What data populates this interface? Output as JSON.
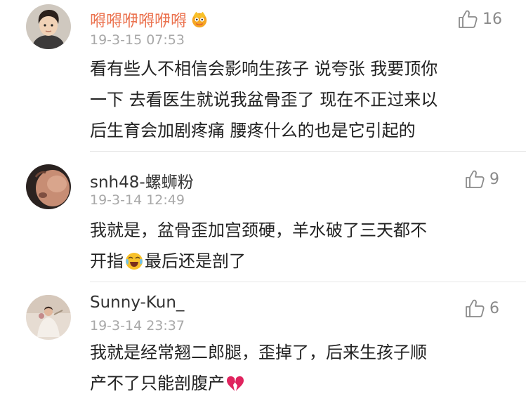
{
  "comments": [
    {
      "username": "嘚嘚咿嘚咿嘚",
      "timestamp": "19-3-15 07:53",
      "likes": "16",
      "text_lines": [
        "看有些人不相信会影响生孩子 说夸张 我要顶你",
        "一下 去看医生就说我盆骨歪了 现在不正过来以",
        "后生育会加剧疼痛 腰疼什么的也是它引起的"
      ],
      "username_color": "#eb7350",
      "avatar_icon": "avatar-cartoon-boy"
    },
    {
      "username": "snh48-螺蛳粉",
      "timestamp": "19-3-14 12:49",
      "likes": "9",
      "text_line1": "我就是，盆骨歪加宫颈硬，羊水破了三天都不",
      "text_line2_a": "开指",
      "text_line2_b": "最后还是剖了",
      "inline_emoji": "crying-laughing-emoji",
      "username_color": "#333333",
      "avatar_icon": "avatar-baby-photo"
    },
    {
      "username": "Sunny-Kun_",
      "timestamp": "19-3-14 23:37",
      "likes": "6",
      "text_line1": "我就是经常翘二郎腿，歪掉了，后来生孩子顺",
      "text_line2": "产不了只能剖腹产",
      "inline_emoji": "broken-heart-emoji",
      "username_color": "#333333",
      "avatar_icon": "avatar-wedding-photo"
    }
  ],
  "colors": {
    "like_icon": "#8a8a8a",
    "timestamp": "#a8a8a8",
    "divider": "#e6e6e6"
  }
}
